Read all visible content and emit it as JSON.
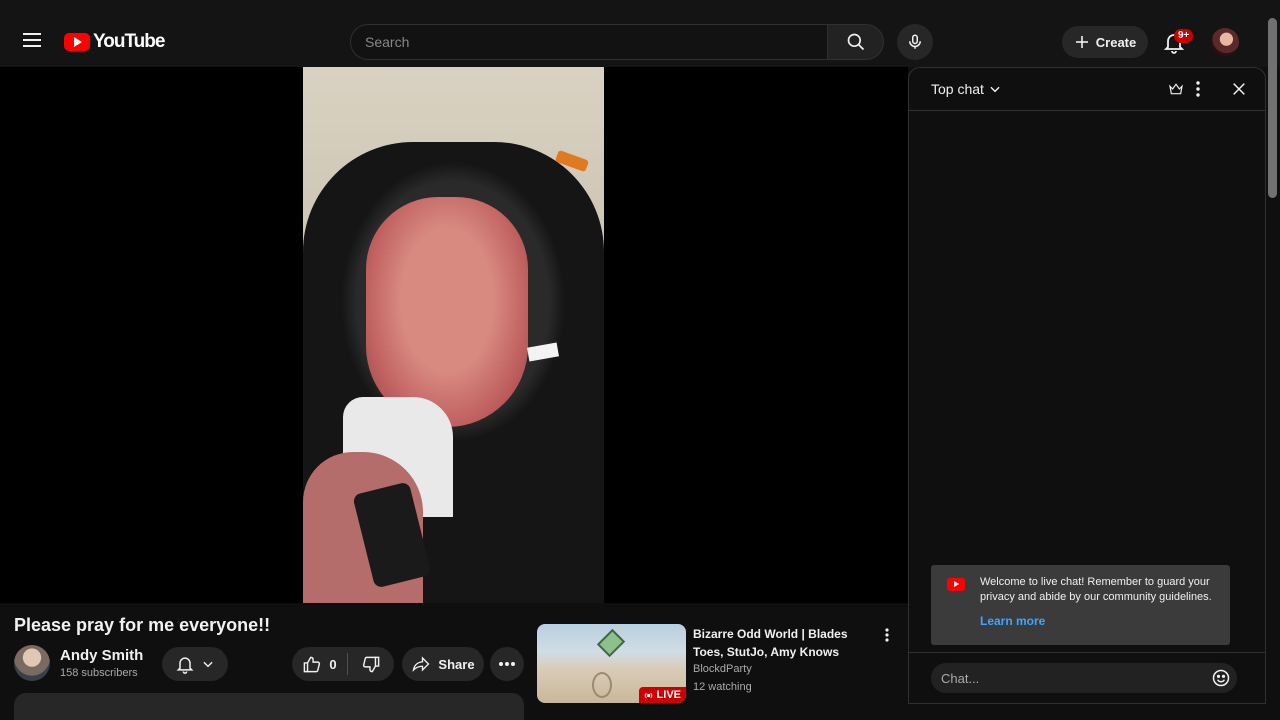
{
  "header": {
    "logo_text": "YouTube",
    "search_placeholder": "Search",
    "create_label": "Create",
    "notification_count": "9+"
  },
  "video": {
    "title": "Please pray for me everyone!!",
    "channel_name": "Andy Smith",
    "subscribers": "158 subscribers",
    "likes": "0",
    "share_label": "Share"
  },
  "recommendation": {
    "title": "Bizarre Odd World | Blades Toes, StutJo, Amy Knows",
    "channel": "BlockdParty",
    "watching": "12 watching",
    "live_label": "LIVE"
  },
  "chat": {
    "mode_label": "Top chat",
    "welcome_text": "Welcome to live chat! Remember to guard your privacy and abide by our community guidelines.",
    "learn_more": "Learn more",
    "input_placeholder": "Chat..."
  },
  "colors": {
    "brand_red": "#ff0000",
    "link_blue": "#3ea6ff",
    "background": "#0f0f0f"
  }
}
